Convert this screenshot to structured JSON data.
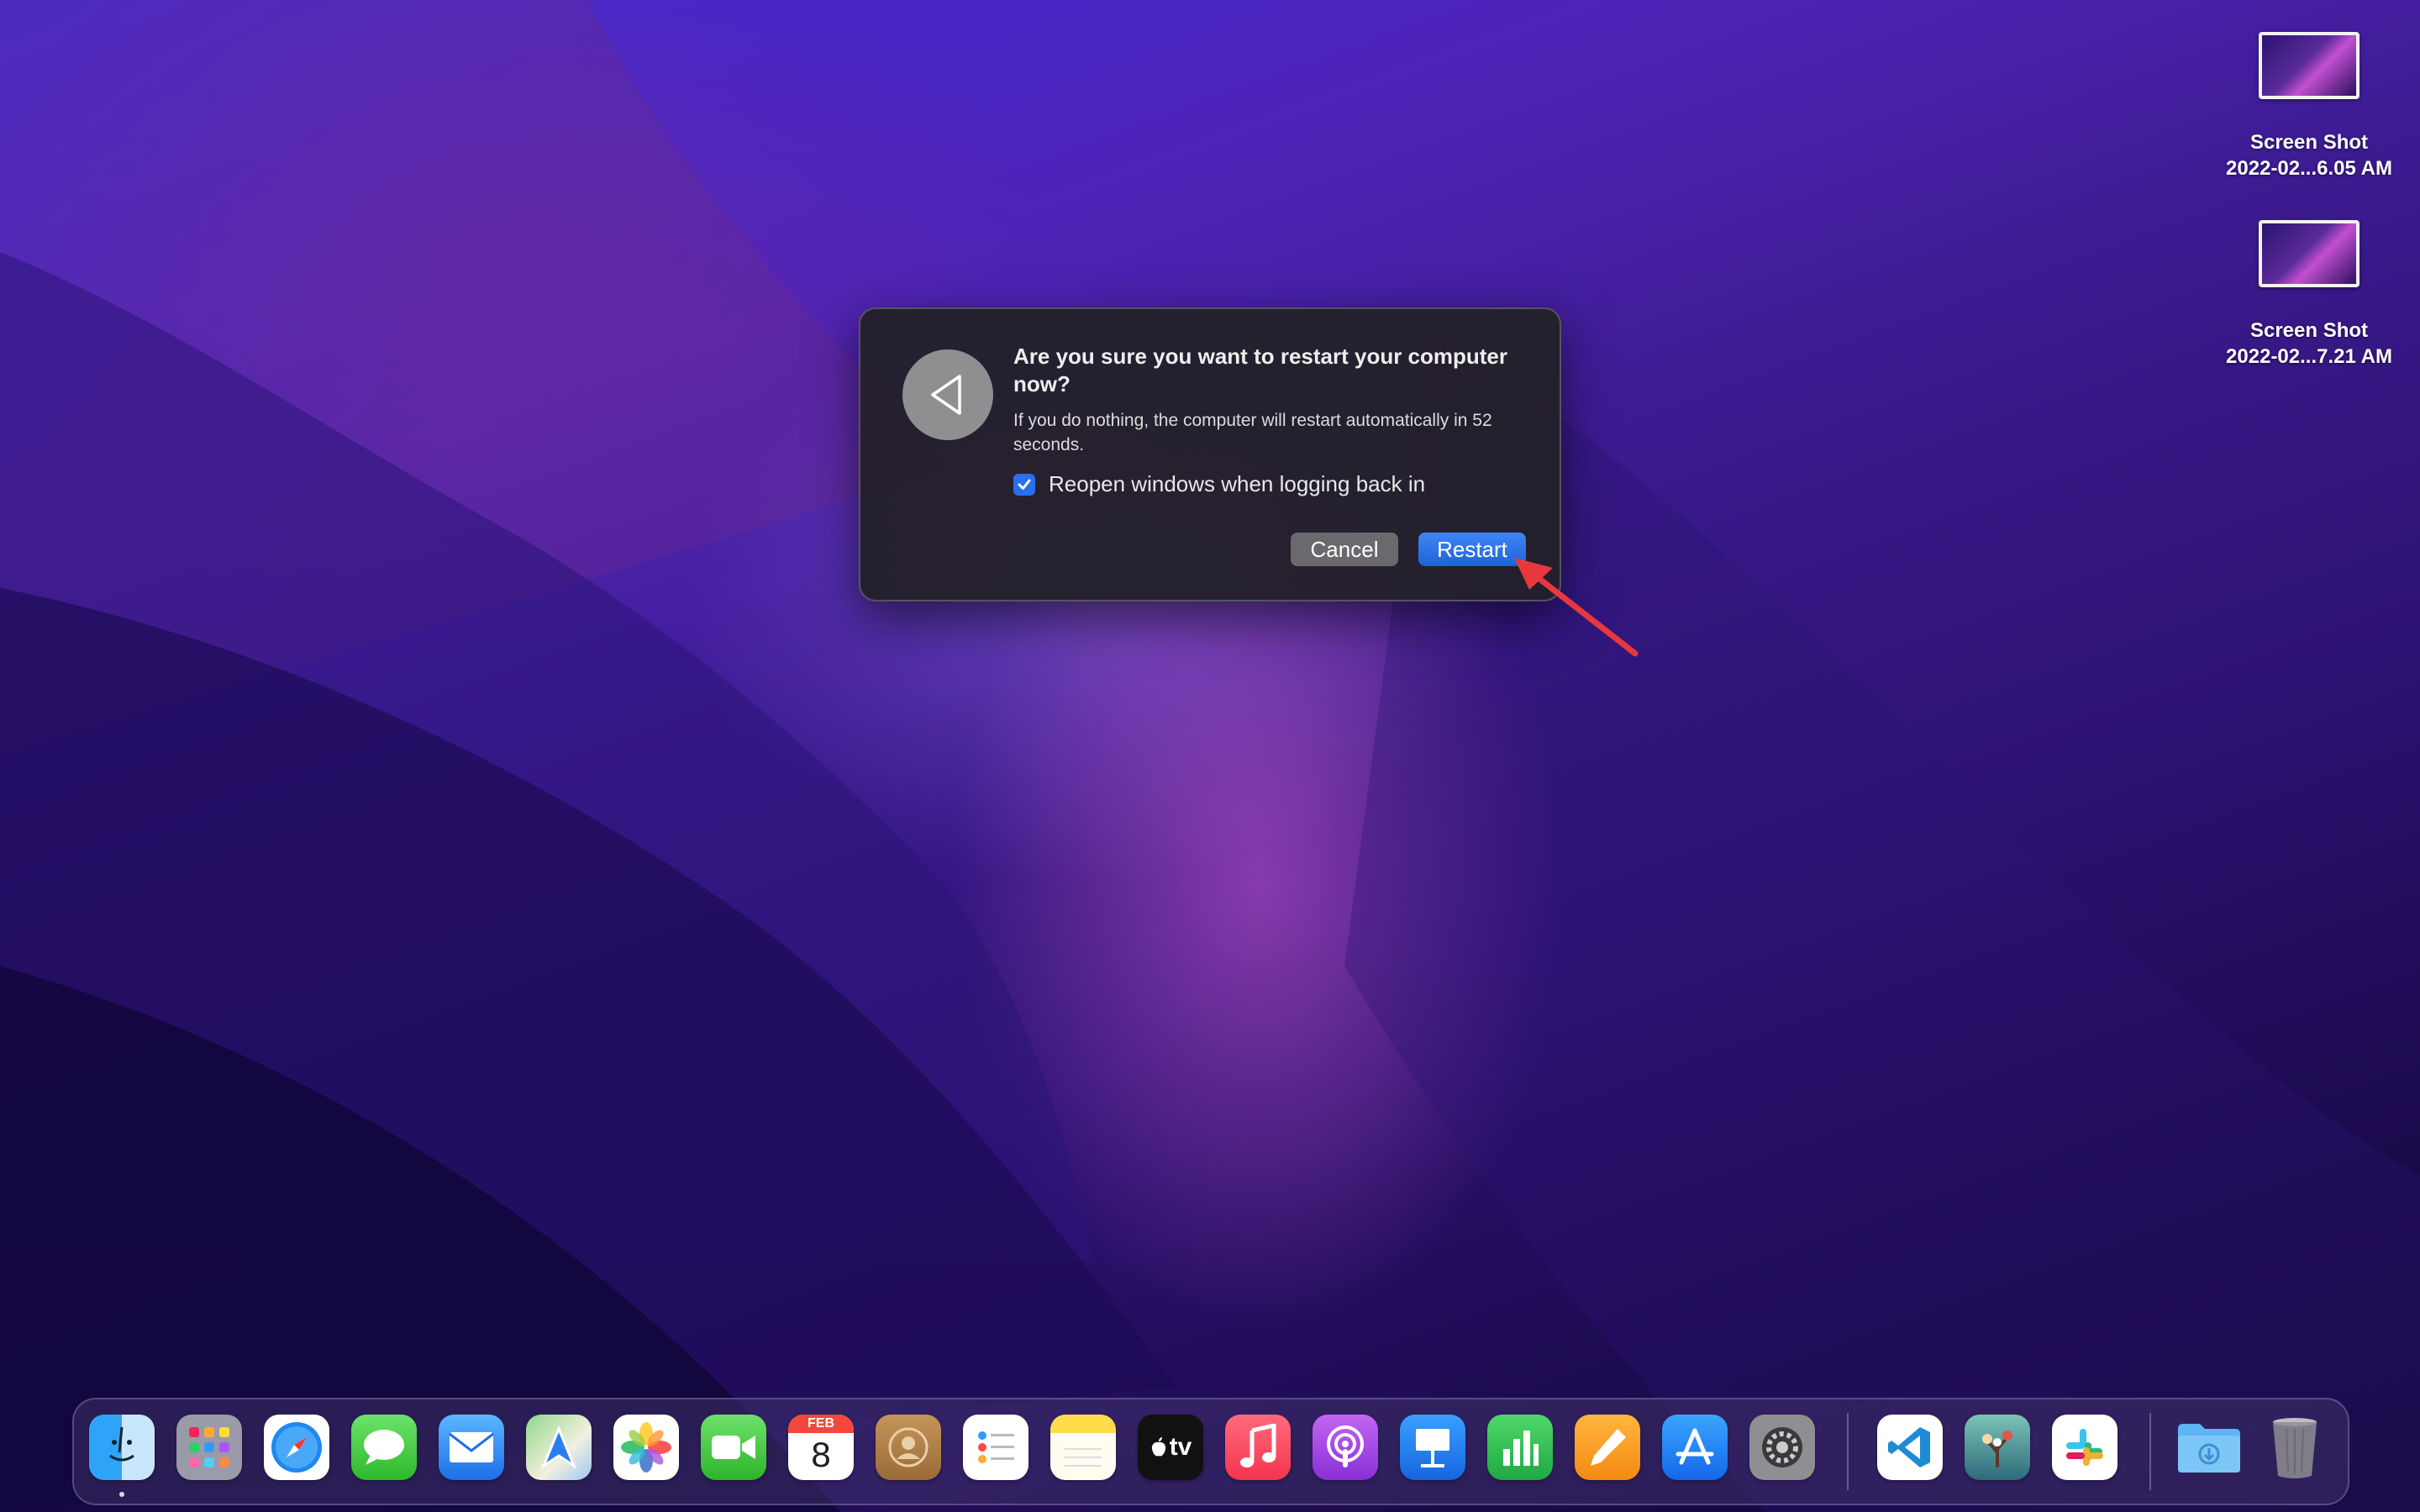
{
  "desktop": {
    "items": [
      {
        "line1": "Screen Shot",
        "line2": "2022-02...6.05 AM"
      },
      {
        "line1": "Screen Shot",
        "line2": "2022-02...7.21 AM"
      }
    ]
  },
  "dialog": {
    "title": "Are you sure you want to restart your computer now?",
    "message": "If you do nothing, the computer will restart automatically in 52 seconds.",
    "checkbox_label": "Reopen windows when logging back in",
    "checkbox_checked": true,
    "cancel_label": "Cancel",
    "restart_label": "Restart"
  },
  "dock": {
    "calendar_month": "FEB",
    "calendar_day": "8",
    "tv_label": "tv",
    "apps": [
      "finder-icon",
      "launchpad-icon",
      "safari-icon",
      "messages-icon",
      "mail-icon",
      "maps-icon",
      "photos-icon",
      "facetime-icon",
      "calendar-icon",
      "contacts-icon",
      "reminders-icon",
      "notes-icon",
      "apple-tv-icon",
      "music-icon",
      "podcasts-icon",
      "keynote-icon",
      "numbers-icon",
      "pages-icon",
      "app-store-icon",
      "system-preferences-icon",
      "vscode-icon",
      "sourcetree-icon",
      "slack-icon",
      "downloads-folder-icon",
      "trash-icon"
    ]
  },
  "colors": {
    "accent": "#2a6ff0",
    "annotation_arrow": "#e8383d"
  }
}
